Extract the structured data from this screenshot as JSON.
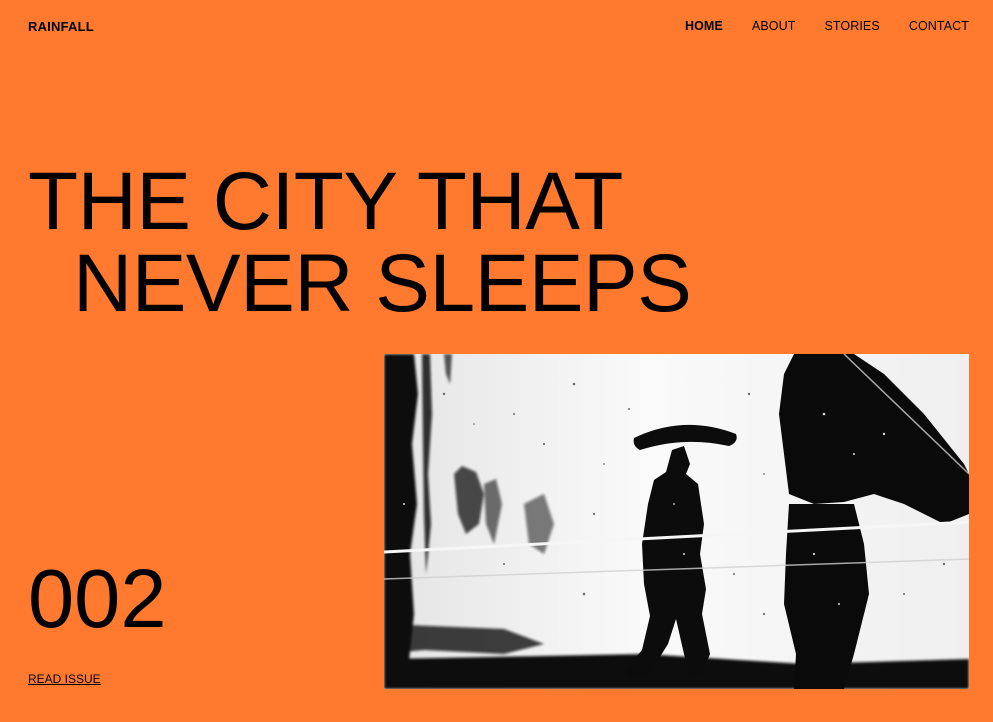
{
  "brand": {
    "name": "RAINFALL"
  },
  "nav": {
    "items": [
      {
        "label": "HOME",
        "active": true
      },
      {
        "label": "ABOUT",
        "active": false
      },
      {
        "label": "STORIES",
        "active": false
      },
      {
        "label": "CONTACT",
        "active": false
      }
    ]
  },
  "hero": {
    "title_line1": "THE CITY THAT",
    "title_line2": "NEVER SLEEPS"
  },
  "issue": {
    "number": "002",
    "read_label": "READ ISSUE"
  },
  "colors": {
    "background": "#ff7a2f",
    "text": "#000000"
  },
  "image": {
    "icon": "rain-reflection-photo"
  }
}
